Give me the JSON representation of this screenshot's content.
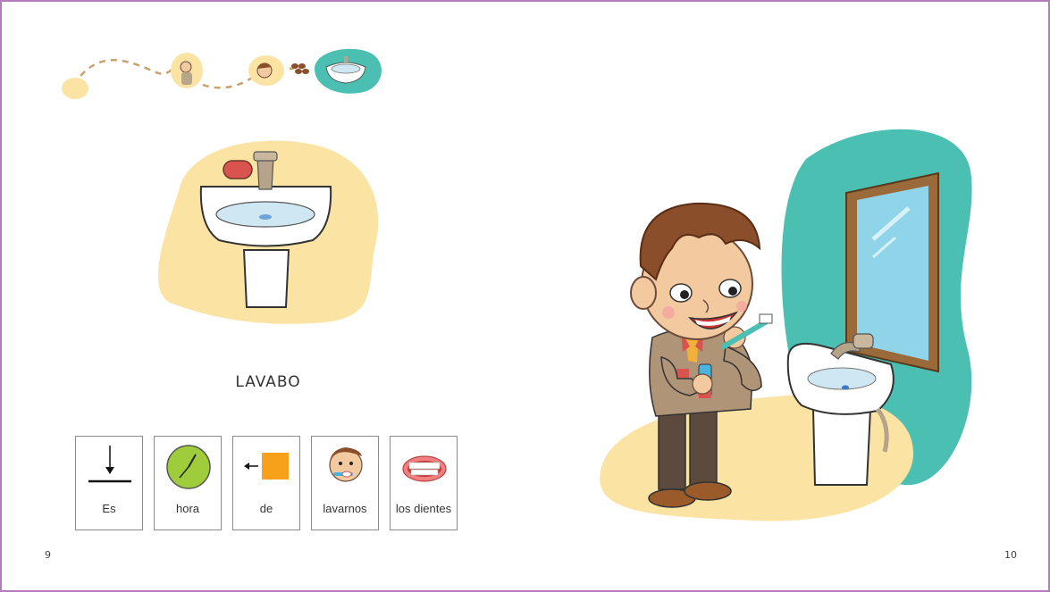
{
  "left_page": {
    "title": "LAVABO",
    "page_number": "9",
    "pictograms": [
      {
        "label": "Es",
        "icon": "arrow-down-to-line-icon"
      },
      {
        "label": "hora",
        "icon": "clock-icon"
      },
      {
        "label": "de",
        "icon": "arrow-to-square-icon"
      },
      {
        "label": "lavarnos",
        "icon": "brushing-teeth-icon"
      },
      {
        "label": "los dientes",
        "icon": "teeth-icon"
      }
    ]
  },
  "right_page": {
    "page_number": "10"
  },
  "colors": {
    "border": "#b57bbd",
    "yellow_blob": "#fbe3a4",
    "teal_blob": "#4bbfb2"
  }
}
